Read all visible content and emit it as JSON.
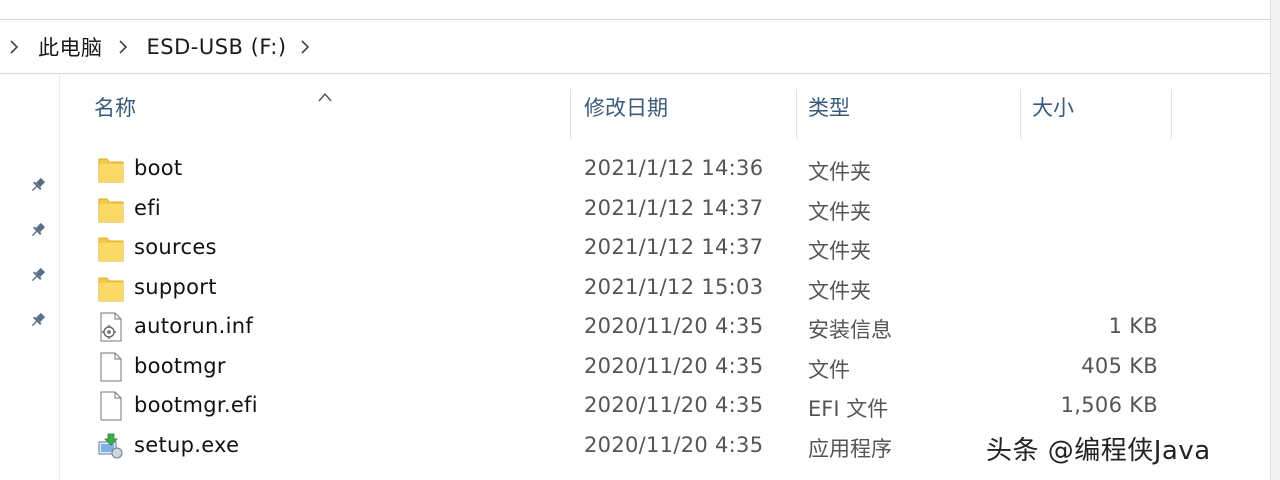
{
  "breadcrumb": {
    "items": [
      "此电脑",
      "ESD-USB (F:)"
    ]
  },
  "columns": {
    "name": "名称",
    "date_modified": "修改日期",
    "type": "类型",
    "size": "大小"
  },
  "files": [
    {
      "name": "boot",
      "date": "2021/1/12 14:36",
      "type": "文件夹",
      "size": "",
      "icon": "folder-icon"
    },
    {
      "name": "efi",
      "date": "2021/1/12 14:37",
      "type": "文件夹",
      "size": "",
      "icon": "folder-icon"
    },
    {
      "name": "sources",
      "date": "2021/1/12 14:37",
      "type": "文件夹",
      "size": "",
      "icon": "folder-icon"
    },
    {
      "name": "support",
      "date": "2021/1/12 15:03",
      "type": "文件夹",
      "size": "",
      "icon": "folder-icon"
    },
    {
      "name": "autorun.inf",
      "date": "2020/11/20 4:35",
      "type": "安装信息",
      "size": "1 KB",
      "icon": "setup-info-file-icon"
    },
    {
      "name": "bootmgr",
      "date": "2020/11/20 4:35",
      "type": "文件",
      "size": "405 KB",
      "icon": "blank-file-icon"
    },
    {
      "name": "bootmgr.efi",
      "date": "2020/11/20 4:35",
      "type": "EFI 文件",
      "size": "1,506 KB",
      "icon": "blank-file-icon"
    },
    {
      "name": "setup.exe",
      "date": "2020/11/20 4:35",
      "type": "应用程序",
      "size": "",
      "icon": "installer-icon"
    }
  ],
  "watermark": "头条 @编程侠Java",
  "colors": {
    "folder": "#f5c94a",
    "header_text": "#3a5a7a",
    "secondary_text": "#555555"
  }
}
